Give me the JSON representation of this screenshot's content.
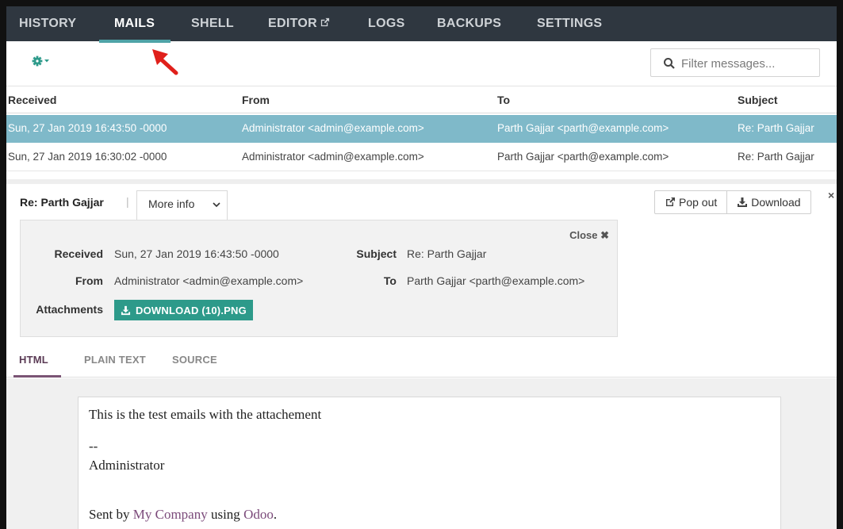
{
  "nav": {
    "tabs": [
      "HISTORY",
      "MAILS",
      "SHELL",
      "EDITOR",
      "LOGS",
      "BACKUPS",
      "SETTINGS"
    ],
    "active": "MAILS"
  },
  "toolbar": {
    "gear_icon": "gear-icon",
    "search_placeholder": "Filter messages..."
  },
  "table": {
    "headers": [
      "Received",
      "From",
      "To",
      "Subject"
    ],
    "rows": [
      {
        "received": "Sun, 27 Jan 2019 16:43:50 -0000",
        "from": "Administrator <admin@example.com>",
        "to": "Parth Gajjar <parth@example.com>",
        "subject": "Re: Parth Gajjar",
        "selected": true
      },
      {
        "received": "Sun, 27 Jan 2019 16:30:02 -0000",
        "from": "Administrator <admin@example.com>",
        "to": "Parth Gajjar <parth@example.com>",
        "subject": "Re: Parth Gajjar",
        "selected": false
      }
    ]
  },
  "detail": {
    "title": "Re: Parth Gajjar",
    "separator": "|",
    "more_info": "More info",
    "pop_out": "Pop out",
    "download": "Download",
    "close_panel": "×",
    "info": {
      "close": "Close",
      "received_label": "Received",
      "received": "Sun, 27 Jan 2019 16:43:50 -0000",
      "subject_label": "Subject",
      "subject": "Re: Parth Gajjar",
      "from_label": "From",
      "from": "Administrator <admin@example.com>",
      "to_label": "To",
      "to": "Parth Gajjar <parth@example.com>",
      "attachments_label": "Attachments",
      "attachment": "DOWNLOAD (10).PNG"
    },
    "view_tabs": [
      "HTML",
      "PLAIN TEXT",
      "SOURCE"
    ],
    "active_view": "HTML"
  },
  "mail_body": {
    "line1": "This is the test emails with the attachement",
    "dash": "--",
    "signature": "Administrator",
    "sent_by": "Sent by",
    "company": "My Company",
    "using": "using",
    "odoo": "Odoo",
    "period": "."
  },
  "colors": {
    "nav_bg": "#2f3740",
    "accent": "#4fa3a7",
    "selected_row": "#7fb9c9",
    "attachment_button": "#2d9a8a",
    "link": "#7b4a7a",
    "annotation_arrow": "#e0201b"
  }
}
